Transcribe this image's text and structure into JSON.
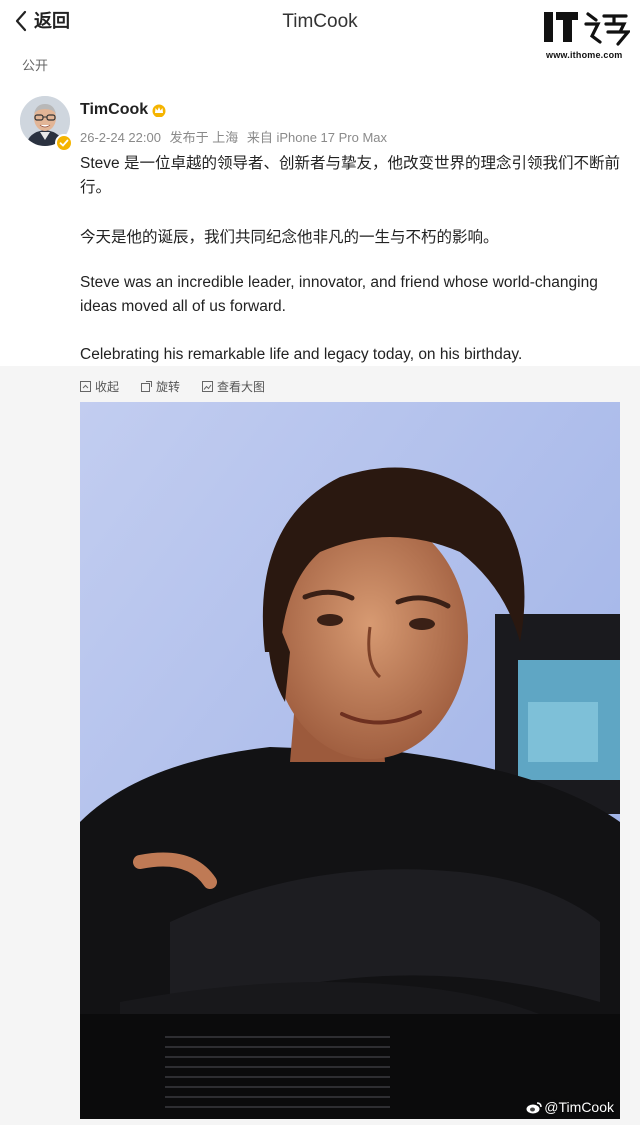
{
  "nav": {
    "back_label": "返回",
    "title": "TimCook"
  },
  "brand": {
    "logo_text": "IT之家",
    "url": "www.ithome.com"
  },
  "visibility": "公开",
  "post": {
    "author": "TimCook",
    "meta": {
      "date": "26-2-24 22:00",
      "location": "发布于 上海",
      "source": "来自 iPhone 17 Pro Max"
    },
    "paragraphs": [
      "Steve 是一位卓越的领导者、创新者与挚友，他改变世界的理念引领我们不断前行。",
      "今天是他的诞辰，我们共同纪念他非凡的一生与不朽的影响。",
      "Steve was an incredible leader, innovator, and friend whose world-changing ideas moved all of us forward.",
      "Celebrating his remarkable life and legacy today, on his birthday."
    ]
  },
  "media_tools": {
    "collapse": "收起",
    "rotate": "旋转",
    "view_full": "查看大图"
  },
  "watermark": "@TimCook",
  "colors": {
    "accent_gold": "#f5b400",
    "photo_bg": "#b9c7ee",
    "meta_gray": "#8a8a8a"
  },
  "icons": [
    "chevron-left-icon",
    "crown-icon",
    "verified-badge-icon",
    "collapse-icon",
    "rotate-icon",
    "view-full-icon",
    "weibo-icon"
  ]
}
